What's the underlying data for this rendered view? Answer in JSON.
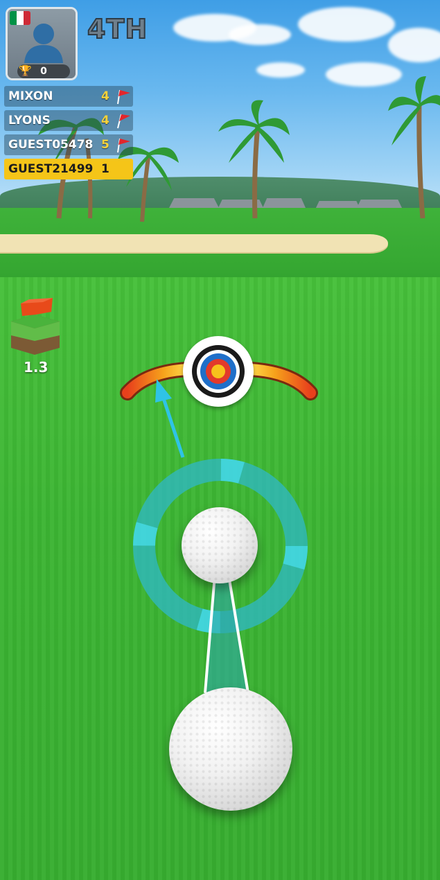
{
  "player": {
    "country_flag": [
      "#009246",
      "#ffffff",
      "#ce2b37"
    ],
    "trophies": "0",
    "rank": "4TH"
  },
  "leaderboard": [
    {
      "name": "MIXON",
      "score": "4",
      "flag_icon": "flag-icon",
      "highlight": false
    },
    {
      "name": "LYONS",
      "score": "4",
      "flag_icon": "flag-icon",
      "highlight": false
    },
    {
      "name": "GUEST05478",
      "score": "5",
      "flag_icon": "flag-icon",
      "highlight": false
    },
    {
      "name": "GUEST21499",
      "score": "1",
      "flag_icon": "",
      "highlight": true
    }
  ],
  "hole": {
    "distance": "1.3",
    "icon": "hole-flag-icon"
  },
  "aim": {
    "target_icon": "bullseye-icon",
    "power_arc_colors": [
      "#e8401c",
      "#f6a21b",
      "#ffd84a"
    ],
    "aim_ring_color": "#2fb8c8"
  },
  "colors": {
    "highlight_row": "#f5c518",
    "score_text": "#f5d23a",
    "flag_red": "#e3262b"
  }
}
